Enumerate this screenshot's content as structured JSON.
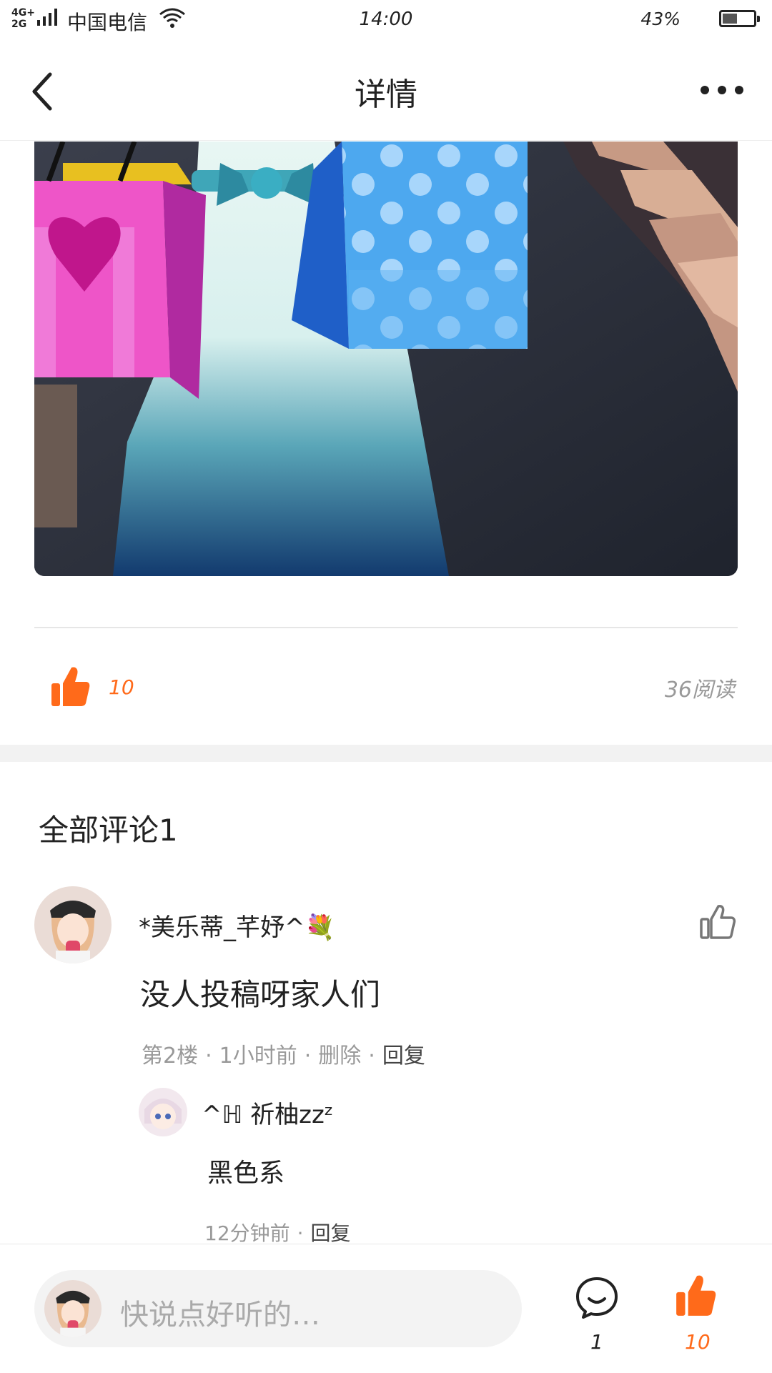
{
  "status_bar": {
    "network": "4G+\n2G",
    "carrier": "中国电信",
    "time": "14:00",
    "battery": "43%"
  },
  "header": {
    "title": "详情",
    "back_icon": "chevron-left-icon",
    "more_icon": "more-dots-icon"
  },
  "post": {
    "likes": "10",
    "reads": "36阅读"
  },
  "comments": {
    "title": "全部评论1",
    "items": [
      {
        "name": "*美乐蒂_芊妤^💐",
        "text": "没人投稿呀家人们",
        "floor": "第2楼",
        "time": "1小时前",
        "delete": "删除",
        "reply": "回复",
        "replies": [
          {
            "name": "^ℍ  祈柚zzᶻ",
            "text": "黑色系",
            "time": "12分钟前",
            "reply": "回复"
          }
        ]
      }
    ]
  },
  "bottom_bar": {
    "placeholder": "快说点好听的…",
    "comment_count": "1",
    "like_count": "10"
  },
  "colors": {
    "accent": "#ff6a1a",
    "muted": "#999999",
    "divider": "#e6e6e6"
  }
}
